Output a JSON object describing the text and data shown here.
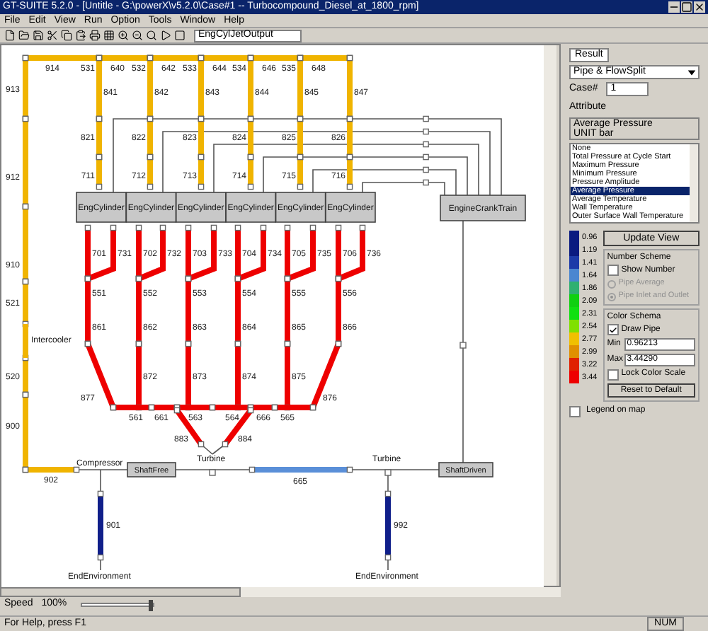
{
  "window": {
    "title": "GT-SUITE 5.2.0 - [Untitle - G:\\powerX\\v5.2.0\\Case#1 -- Turbocompound_Diesel_at_1800_rpm]"
  },
  "menu": [
    "File",
    "Edit",
    "View",
    "Run",
    "Option",
    "Tools",
    "Window",
    "Help"
  ],
  "toolbar": {
    "combo": "EngCylJetOutput"
  },
  "diagram": {
    "pipes": [
      {
        "label": "914",
        "color": "#f0b400"
      },
      {
        "label": "640",
        "color": "#f0b400"
      },
      {
        "label": "642",
        "color": "#f0b400"
      },
      {
        "label": "644",
        "color": "#f0b400"
      },
      {
        "label": "646",
        "color": "#f0b400"
      },
      {
        "label": "648",
        "color": "#f0b400"
      },
      {
        "label": "913",
        "color": "#f0b400"
      },
      {
        "label": "912",
        "color": "#f0b400"
      },
      {
        "label": "910",
        "color": "#f0b400"
      },
      {
        "label": "521",
        "color": "#f0b400"
      },
      {
        "label": "520",
        "color": "#f0b400"
      },
      {
        "label": "900",
        "color": "#f0b400"
      },
      {
        "label": "902",
        "color": "#f0b400"
      },
      {
        "label": "841",
        "color": "#f0b400"
      },
      {
        "label": "821",
        "color": "#f0b400"
      },
      {
        "label": "711",
        "color": "#f0b400"
      },
      {
        "label": "842",
        "color": "#f0b400"
      },
      {
        "label": "822",
        "color": "#f0b400"
      },
      {
        "label": "712",
        "color": "#f0b400"
      },
      {
        "label": "843",
        "color": "#f0b400"
      },
      {
        "label": "823",
        "color": "#f0b400"
      },
      {
        "label": "713",
        "color": "#f0b400"
      },
      {
        "label": "844",
        "color": "#f0b400"
      },
      {
        "label": "824",
        "color": "#f0b400"
      },
      {
        "label": "714",
        "color": "#f0b400"
      },
      {
        "label": "845",
        "color": "#f0b400"
      },
      {
        "label": "825",
        "color": "#f0b400"
      },
      {
        "label": "715",
        "color": "#f0b400"
      },
      {
        "label": "847",
        "color": "#f0b400"
      },
      {
        "label": "826",
        "color": "#f0b400"
      },
      {
        "label": "716",
        "color": "#f0b400"
      },
      {
        "label": "701",
        "color": "#ee0000"
      },
      {
        "label": "731",
        "color": "#ee0000"
      },
      {
        "label": "861",
        "color": "#ee0000"
      },
      {
        "label": "702",
        "color": "#ee0000"
      },
      {
        "label": "732",
        "color": "#ee0000"
      },
      {
        "label": "862",
        "color": "#ee0000"
      },
      {
        "label": "703",
        "color": "#ee0000"
      },
      {
        "label": "733",
        "color": "#ee0000"
      },
      {
        "label": "863",
        "color": "#ee0000"
      },
      {
        "label": "704",
        "color": "#ee0000"
      },
      {
        "label": "734",
        "color": "#ee0000"
      },
      {
        "label": "864",
        "color": "#ee0000"
      },
      {
        "label": "705",
        "color": "#ee0000"
      },
      {
        "label": "735",
        "color": "#ee0000"
      },
      {
        "label": "865",
        "color": "#ee0000"
      },
      {
        "label": "706",
        "color": "#ee0000"
      },
      {
        "label": "736",
        "color": "#ee0000"
      },
      {
        "label": "866",
        "color": "#ee0000"
      },
      {
        "label": "877",
        "color": "#ee0000"
      },
      {
        "label": "872",
        "color": "#ee0000"
      },
      {
        "label": "873",
        "color": "#ee0000"
      },
      {
        "label": "874",
        "color": "#ee0000"
      },
      {
        "label": "875",
        "color": "#ee0000"
      },
      {
        "label": "876",
        "color": "#ee0000"
      },
      {
        "label": "561",
        "color": "#ee0000"
      },
      {
        "label": "661",
        "color": "#ee0000"
      },
      {
        "label": "563",
        "color": "#ee0000"
      },
      {
        "label": "564",
        "color": "#ee0000"
      },
      {
        "label": "666",
        "color": "#ee0000"
      },
      {
        "label": "565",
        "color": "#ee0000"
      },
      {
        "label": "883",
        "color": "#ee0000"
      },
      {
        "label": "884",
        "color": "#ee0000"
      },
      {
        "label": "665",
        "color": "#5a8fd8"
      },
      {
        "label": "901",
        "color": "#101f8a"
      },
      {
        "label": "992",
        "color": "#101f8a"
      }
    ],
    "splits": [
      "531",
      "532",
      "533",
      "534",
      "535",
      "551",
      "552",
      "553",
      "554",
      "555",
      "556"
    ],
    "components": [
      {
        "label": "EngCylinder",
        "kind": "box"
      },
      {
        "label": "EngCylinder",
        "kind": "box"
      },
      {
        "label": "EngCylinder",
        "kind": "box"
      },
      {
        "label": "EngCylinder",
        "kind": "box"
      },
      {
        "label": "EngCylinder",
        "kind": "box"
      },
      {
        "label": "EngCylinder",
        "kind": "box"
      },
      {
        "label": "EngineCrankTrain",
        "kind": "box"
      },
      {
        "label": "Intercooler",
        "kind": "label"
      },
      {
        "label": "Compressor",
        "kind": "label"
      },
      {
        "label": "ShaftFree",
        "kind": "box"
      },
      {
        "label": "Turbine",
        "kind": "label"
      },
      {
        "label": "Turbine",
        "kind": "label"
      },
      {
        "label": "ShaftDriven",
        "kind": "box"
      },
      {
        "label": "EndEnvironment",
        "kind": "label"
      },
      {
        "label": "EndEnvironment",
        "kind": "label"
      }
    ]
  },
  "speed": {
    "label": "Speed",
    "value": "100%",
    "level": 1
  },
  "panel": {
    "tab": "Result",
    "type_select": "Pipe & FlowSplit",
    "case_label": "Case#",
    "case_value": "1",
    "attribute_label": "Attribute",
    "attribute_info": [
      "Average Pressure",
      "UNIT bar"
    ],
    "attributes": [
      {
        "label": "None",
        "selected": false
      },
      {
        "label": "Total Pressure at Cycle Start",
        "selected": false
      },
      {
        "label": "Maximum Pressure",
        "selected": false
      },
      {
        "label": "Minimum Pressure",
        "selected": false
      },
      {
        "label": "Pressure Amplitude",
        "selected": false
      },
      {
        "label": "Average Pressure",
        "selected": true
      },
      {
        "label": "Average Temperature",
        "selected": false
      },
      {
        "label": "Wall Temperature",
        "selected": false
      },
      {
        "label": "Outer Surface Wall Temperature",
        "selected": false
      }
    ],
    "legend": [
      {
        "label": "0.96",
        "color": "#0a1a80"
      },
      {
        "label": "1.19",
        "color": "#0a1a80"
      },
      {
        "label": "1.41",
        "color": "#1c3aa8"
      },
      {
        "label": "1.64",
        "color": "#4a86d0"
      },
      {
        "label": "1.86",
        "color": "#30b070"
      },
      {
        "label": "2.09",
        "color": "#10d010"
      },
      {
        "label": "2.31",
        "color": "#10e010"
      },
      {
        "label": "2.54",
        "color": "#80e000"
      },
      {
        "label": "2.77",
        "color": "#f0c000"
      },
      {
        "label": "2.99",
        "color": "#e09000"
      },
      {
        "label": "3.22",
        "color": "#e02000"
      },
      {
        "label": "3.44",
        "color": "#ee0000"
      }
    ],
    "update_button": "Update View",
    "number_scheme": {
      "title": "Number Scheme",
      "show_number": {
        "label": "Show Number",
        "checked": false
      },
      "options": [
        {
          "label": "Pipe Average",
          "selected": false,
          "disabled": true
        },
        {
          "label": "Pipe Inlet and Outlet",
          "selected": true,
          "disabled": true
        }
      ]
    },
    "color_schema": {
      "title": "Color Schema",
      "draw_pipe": {
        "label": "Draw Pipe",
        "checked": true
      },
      "min_label": "Min",
      "min_value": "0.96213",
      "max_label": "Max",
      "max_value": "3.44290",
      "lock": {
        "label": "Lock Color Scale",
        "checked": false
      },
      "reset_button": "Reset to Default"
    },
    "legend_on_map": {
      "label": "Legend on map",
      "checked": false
    }
  },
  "status_bar": {
    "help": "For Help, press F1",
    "num": "NUM"
  }
}
